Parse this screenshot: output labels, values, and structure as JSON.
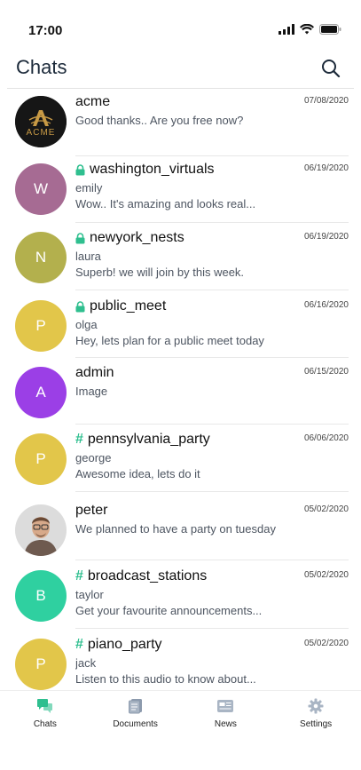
{
  "status_bar": {
    "time": "17:00"
  },
  "header": {
    "title": "Chats"
  },
  "chats": [
    {
      "name": "acme",
      "date": "07/08/2020",
      "sender": "",
      "message": "Good thanks.. Are you free now?",
      "type": "direct",
      "avatar_text": "ACME",
      "avatar_color": "#1a1a1a"
    },
    {
      "name": "washington_virtuals",
      "date": "06/19/2020",
      "sender": "emily",
      "message": "Wow.. It's amazing and looks real...",
      "type": "locked",
      "avatar_text": "W",
      "avatar_color": "#a66b93"
    },
    {
      "name": "newyork_nests",
      "date": "06/19/2020",
      "sender": "laura",
      "message": "Superb! we will join by this week.",
      "type": "locked",
      "avatar_text": "N",
      "avatar_color": "#b3b04d"
    },
    {
      "name": "public_meet",
      "date": "06/16/2020",
      "sender": "olga",
      "message": "Hey, lets plan for a public meet today",
      "type": "locked",
      "avatar_text": "P",
      "avatar_color": "#e2c64a"
    },
    {
      "name": "admin",
      "date": "06/15/2020",
      "sender": "",
      "message": "Image",
      "type": "direct",
      "avatar_text": "A",
      "avatar_color": "#9b3fe6"
    },
    {
      "name": "pennsylvania_party",
      "date": "06/06/2020",
      "sender": "george",
      "message": "Awesome idea, lets do it",
      "type": "channel",
      "avatar_text": "P",
      "avatar_color": "#e2c64a"
    },
    {
      "name": "peter",
      "date": "05/02/2020",
      "sender": "",
      "message": "We planned to have a party on tuesday",
      "type": "direct",
      "avatar_text": "",
      "avatar_color": "#8a7f77"
    },
    {
      "name": "broadcast_stations",
      "date": "05/02/2020",
      "sender": "taylor",
      "message": "Get your favourite announcements...",
      "type": "channel",
      "avatar_text": "B",
      "avatar_color": "#2fd0a0"
    },
    {
      "name": "piano_party",
      "date": "05/02/2020",
      "sender": "jack",
      "message": "Listen to this audio to know about...",
      "type": "channel",
      "avatar_text": "P",
      "avatar_color": "#e2c64a"
    }
  ],
  "tab_bar": {
    "tabs": [
      {
        "label": "Chats",
        "icon": "chat-bubbles-icon",
        "active": true
      },
      {
        "label": "Documents",
        "icon": "documents-icon",
        "active": false
      },
      {
        "label": "News",
        "icon": "news-icon",
        "active": false
      },
      {
        "label": "Settings",
        "icon": "gear-icon",
        "active": false
      }
    ]
  },
  "colors": {
    "accent": "#2fbf8f",
    "inactive_icon": "#8c9aad"
  }
}
